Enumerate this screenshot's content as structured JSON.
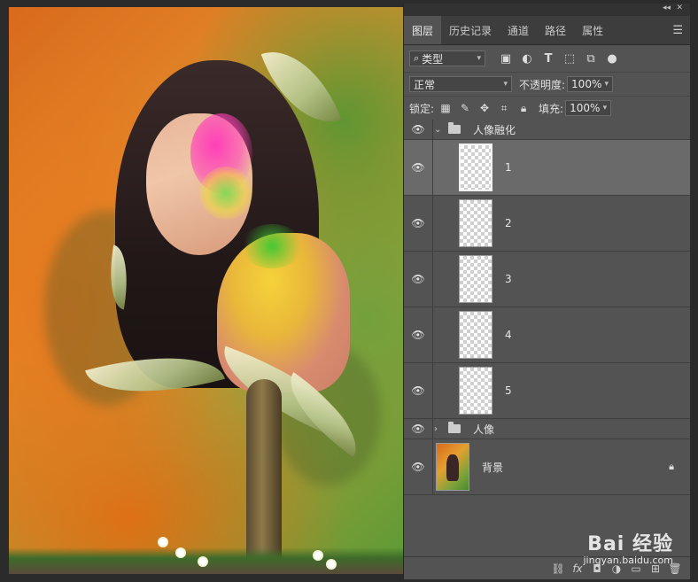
{
  "panel": {
    "top": {
      "collapse_icon": "double-chevron-icon",
      "close_icon": "close-icon"
    },
    "tabs": [
      {
        "label": "图层",
        "active": true
      },
      {
        "label": "历史记录",
        "active": false
      },
      {
        "label": "通道",
        "active": false
      },
      {
        "label": "路径",
        "active": false
      },
      {
        "label": "属性",
        "active": false
      }
    ],
    "filter": {
      "kind_label": "类型",
      "icons": [
        "image-filter-icon",
        "adjustment-filter-icon",
        "text-filter-icon",
        "shape-filter-icon",
        "smart-object-filter-icon",
        "filter-toggle-icon"
      ]
    },
    "blend": {
      "mode": "正常",
      "opacity_label": "不透明度:",
      "opacity_value": "100%"
    },
    "lock": {
      "label": "锁定:",
      "fill_label": "填充:",
      "fill_value": "100%",
      "icons": [
        "lock-transparent-icon",
        "lock-paint-icon",
        "lock-position-icon",
        "lock-artboard-icon",
        "lock-all-icon"
      ]
    },
    "layers": [
      {
        "type": "group",
        "name": "人像融化",
        "expanded": true
      },
      {
        "type": "layer",
        "name": "1",
        "selected": true
      },
      {
        "type": "layer",
        "name": "2",
        "selected": false
      },
      {
        "type": "layer",
        "name": "3",
        "selected": false
      },
      {
        "type": "layer",
        "name": "4",
        "selected": false
      },
      {
        "type": "layer",
        "name": "5",
        "selected": false
      },
      {
        "type": "group",
        "name": "人像",
        "expanded": false
      },
      {
        "type": "background",
        "name": "背景",
        "locked": true
      }
    ],
    "bottom_icons": [
      "link-layers-icon",
      "fx-icon",
      "mask-icon",
      "adjustment-icon",
      "group-icon",
      "new-layer-icon",
      "trash-icon"
    ]
  },
  "watermark": {
    "main": "Bai 经验",
    "sub": "jingyan.baidu.com"
  },
  "colors": {
    "panel_bg": "#535353",
    "selected_layer": "#6a6a6a",
    "tab_bar": "#3d3d3d"
  }
}
